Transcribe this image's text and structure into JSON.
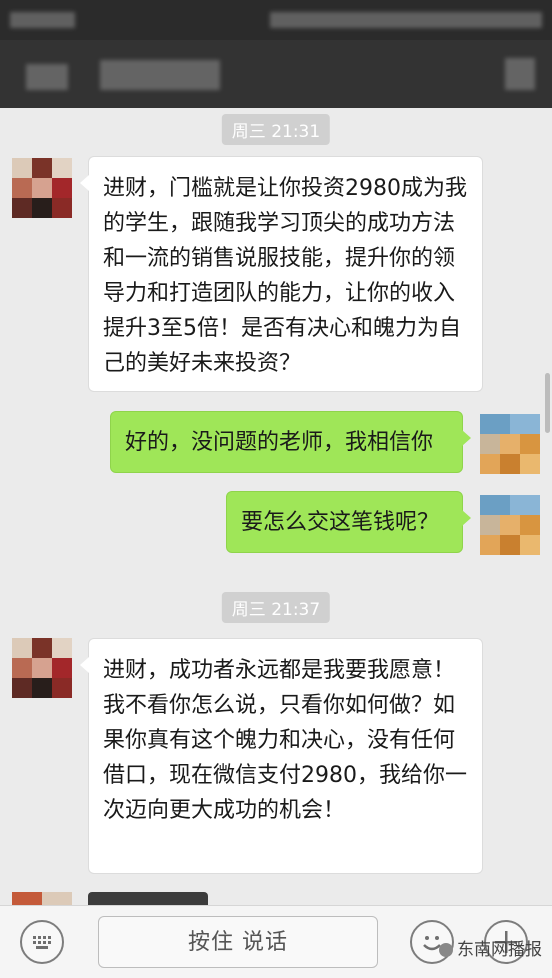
{
  "chat": {
    "messages": [
      {
        "type": "time",
        "text": "周三 21:31"
      },
      {
        "type": "incoming",
        "text": "进财，门槛就是让你投资2980成为我的学生，跟随我学习顶尖的成功方法和一流的销售说服技能，提升你的领导力和打造团队的能力，让你的收入提升3至5倍！是否有决心和魄力为自己的美好未来投资？"
      },
      {
        "type": "outgoing",
        "text": "好的，没问题的老师，我相信你"
      },
      {
        "type": "outgoing",
        "text": "要怎么交这笔钱呢？"
      },
      {
        "type": "time",
        "text": "周三 21:37"
      },
      {
        "type": "incoming",
        "text": "进财，成功者永远都是我要我愿意！我不看你怎么说，只看你如何做？如果你真有这个魄力和决心，没有任何借口，现在微信支付2980，我给你一次迈向更大成功的机会！"
      }
    ]
  },
  "input_bar": {
    "voice_button_label": "按住 说话",
    "keyboard_icon": "keyboard-icon",
    "emoji_icon": "emoji-icon",
    "add_icon": "plus-icon"
  },
  "watermark": {
    "text": "东南网播报"
  },
  "colors": {
    "incoming_bubble": "#ffffff",
    "outgoing_bubble": "#9fe658",
    "chat_background": "#ebebeb",
    "header_background": "#333333"
  }
}
